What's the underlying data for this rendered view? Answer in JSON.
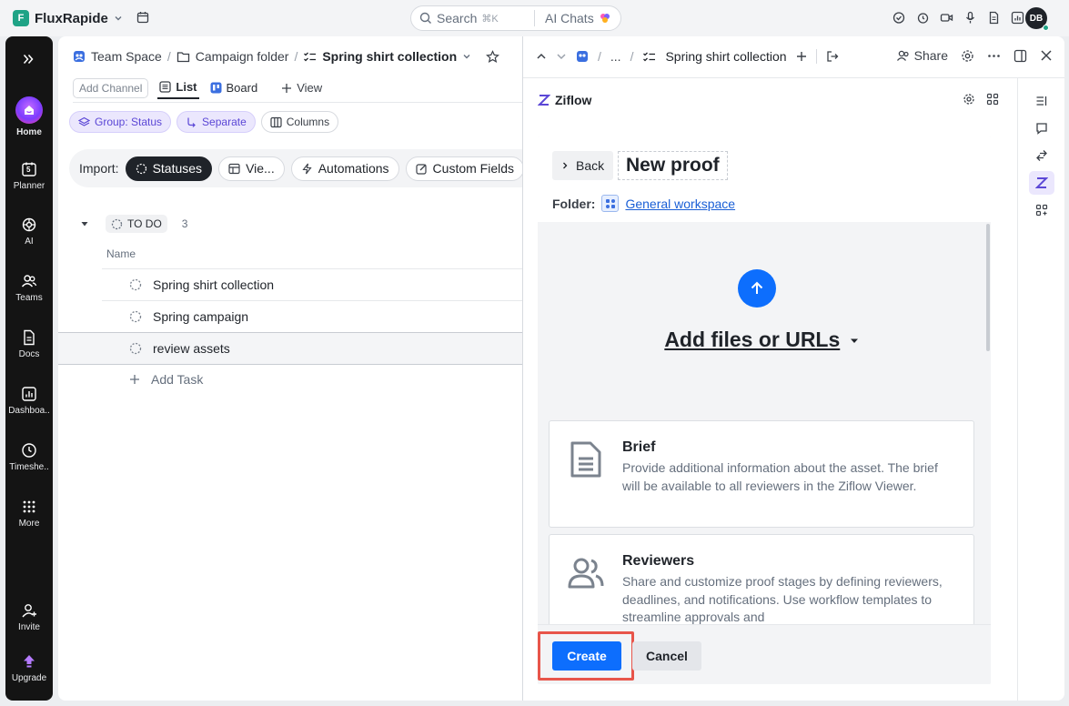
{
  "topbar": {
    "workspace_initial": "F",
    "workspace_name": "FluxRapide",
    "search_label": "Search",
    "search_shortcut": "⌘K",
    "ai_chats_label": "AI Chats",
    "avatar_initials": "DB"
  },
  "sidebar": {
    "items": [
      {
        "label": "Home",
        "icon": "home-icon"
      },
      {
        "label": "Planner",
        "icon": "calendar-icon"
      },
      {
        "label": "AI",
        "icon": "ai-icon"
      },
      {
        "label": "Teams",
        "icon": "teams-icon"
      },
      {
        "label": "Docs",
        "icon": "docs-icon"
      },
      {
        "label": "Dashboa..",
        "icon": "dashboard-icon"
      },
      {
        "label": "Timeshe..",
        "icon": "clock-icon"
      },
      {
        "label": "More",
        "icon": "grid-icon"
      },
      {
        "label": "Invite",
        "icon": "invite-icon"
      },
      {
        "label": "Upgrade",
        "icon": "upgrade-icon"
      }
    ],
    "planner_day": "5"
  },
  "breadcrumb": {
    "space": "Team Space",
    "folder": "Campaign folder",
    "list": "Spring shirt collection"
  },
  "views": {
    "add_channel": "Add Channel",
    "list": "List",
    "board": "Board",
    "add_view": "View"
  },
  "filters": {
    "group": "Group: Status",
    "separate": "Separate",
    "columns": "Columns"
  },
  "import_bar": {
    "label": "Import:",
    "items": [
      "Statuses",
      "Vie...",
      "Automations",
      "Custom Fields"
    ]
  },
  "task_group": {
    "status": "TO DO",
    "count": "3",
    "column_name": "Name",
    "tasks": [
      "Spring shirt collection",
      "Spring campaign",
      "review assets"
    ],
    "add_task": "Add Task"
  },
  "panel": {
    "breadcrumb_ellipsis": "...",
    "title": "Spring shirt collection",
    "share": "Share",
    "app_name": "Ziflow",
    "back": "Back",
    "proof_title": "New proof",
    "folder_label": "Folder:",
    "folder_value": "General workspace",
    "upload_label": "Add files or URLs",
    "options": [
      {
        "title": "Brief",
        "description": "Provide additional information about the asset. The brief will be available to all reviewers in the Ziflow Viewer.",
        "icon": "document-icon"
      },
      {
        "title": "Reviewers",
        "description": "Share and customize proof stages by defining reviewers, deadlines, and notifications. Use workflow templates to streamline approvals and",
        "icon": "users-icon"
      }
    ],
    "create": "Create",
    "cancel": "Cancel"
  },
  "colors": {
    "accent_blue": "#0d6efd",
    "highlight": "#e8554a",
    "sidebar_bg": "#141414",
    "chip_purple": "#5b47d6"
  }
}
